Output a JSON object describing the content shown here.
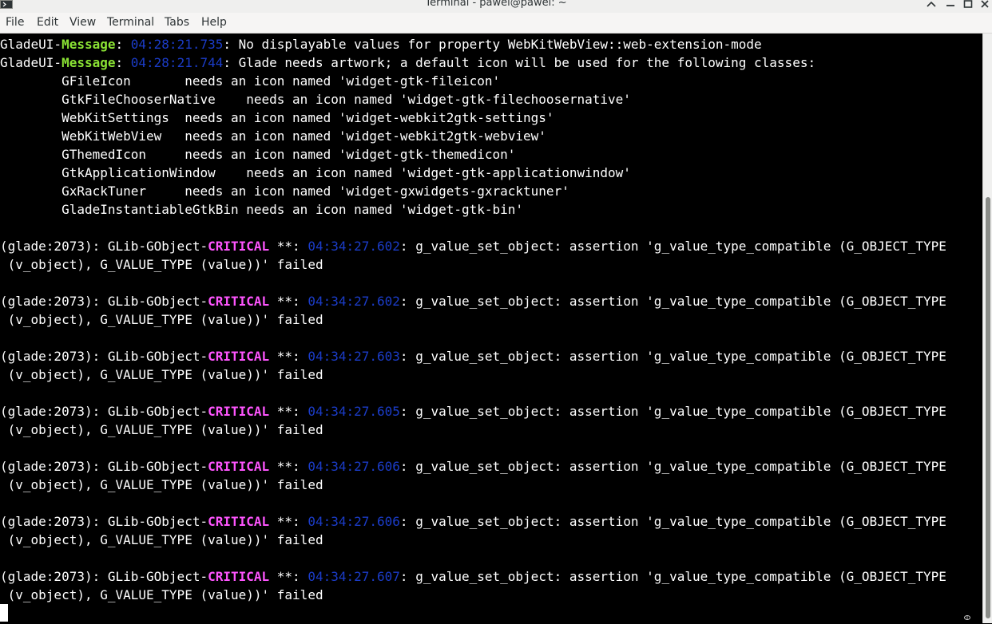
{
  "window": {
    "title": "Terminal - pawel@pawel: ~"
  },
  "menu": [
    "File",
    "Edit",
    "View",
    "Terminal",
    "Tabs",
    "Help"
  ],
  "colors": {
    "background": "#000000",
    "text": "#ffffff",
    "message_accent": "#8ae234",
    "critical_accent": "#ff55ff",
    "timestamp": "#1b3cc8"
  },
  "lines": [
    {
      "segs": [
        {
          "t": "GladeUI-"
        },
        {
          "t": "Message",
          "c": "green"
        },
        {
          "t": ": "
        },
        {
          "t": "04:28:21.735",
          "c": "ts"
        },
        {
          "t": ": No displayable values for property WebKitWebView::web-extension-mode"
        }
      ]
    },
    {
      "segs": [
        {
          "t": "GladeUI-"
        },
        {
          "t": "Message",
          "c": "green"
        },
        {
          "t": ": "
        },
        {
          "t": "04:28:21.744",
          "c": "ts"
        },
        {
          "t": ": Glade needs artwork; a default icon will be used for the following classes:"
        }
      ]
    },
    {
      "segs": [
        {
          "t": "        GFileIcon       needs an icon named 'widget-gtk-fileicon'"
        }
      ]
    },
    {
      "segs": [
        {
          "t": "        GtkFileChooserNative    needs an icon named 'widget-gtk-filechoosernative'"
        }
      ]
    },
    {
      "segs": [
        {
          "t": "        WebKitSettings  needs an icon named 'widget-webkit2gtk-settings'"
        }
      ]
    },
    {
      "segs": [
        {
          "t": "        WebKitWebView   needs an icon named 'widget-webkit2gtk-webview'"
        }
      ]
    },
    {
      "segs": [
        {
          "t": "        GThemedIcon     needs an icon named 'widget-gtk-themedicon'"
        }
      ]
    },
    {
      "segs": [
        {
          "t": "        GtkApplicationWindow    needs an icon named 'widget-gtk-applicationwindow'"
        }
      ]
    },
    {
      "segs": [
        {
          "t": "        GxRackTuner     needs an icon named 'widget-gxwidgets-gxracktuner'"
        }
      ]
    },
    {
      "segs": [
        {
          "t": "        GladeInstantiableGtkBin needs an icon named 'widget-gtk-bin'"
        }
      ]
    },
    {
      "segs": []
    },
    {
      "segs": [
        {
          "t": "(glade:2073): GLib-GObject-"
        },
        {
          "t": "CRITICAL",
          "c": "magenta"
        },
        {
          "t": " **: "
        },
        {
          "t": "04:34:27.602",
          "c": "ts"
        },
        {
          "t": ": g_value_set_object: assertion 'g_value_type_compatible (G_OBJECT_TYPE"
        }
      ]
    },
    {
      "segs": [
        {
          "t": " (v_object), G_VALUE_TYPE (value))' failed"
        }
      ]
    },
    {
      "segs": []
    },
    {
      "segs": [
        {
          "t": "(glade:2073): GLib-GObject-"
        },
        {
          "t": "CRITICAL",
          "c": "magenta"
        },
        {
          "t": " **: "
        },
        {
          "t": "04:34:27.602",
          "c": "ts"
        },
        {
          "t": ": g_value_set_object: assertion 'g_value_type_compatible (G_OBJECT_TYPE"
        }
      ]
    },
    {
      "segs": [
        {
          "t": " (v_object), G_VALUE_TYPE (value))' failed"
        }
      ]
    },
    {
      "segs": []
    },
    {
      "segs": [
        {
          "t": "(glade:2073): GLib-GObject-"
        },
        {
          "t": "CRITICAL",
          "c": "magenta"
        },
        {
          "t": " **: "
        },
        {
          "t": "04:34:27.603",
          "c": "ts"
        },
        {
          "t": ": g_value_set_object: assertion 'g_value_type_compatible (G_OBJECT_TYPE"
        }
      ]
    },
    {
      "segs": [
        {
          "t": " (v_object), G_VALUE_TYPE (value))' failed"
        }
      ]
    },
    {
      "segs": []
    },
    {
      "segs": [
        {
          "t": "(glade:2073): GLib-GObject-"
        },
        {
          "t": "CRITICAL",
          "c": "magenta"
        },
        {
          "t": " **: "
        },
        {
          "t": "04:34:27.605",
          "c": "ts"
        },
        {
          "t": ": g_value_set_object: assertion 'g_value_type_compatible (G_OBJECT_TYPE"
        }
      ]
    },
    {
      "segs": [
        {
          "t": " (v_object), G_VALUE_TYPE (value))' failed"
        }
      ]
    },
    {
      "segs": []
    },
    {
      "segs": [
        {
          "t": "(glade:2073): GLib-GObject-"
        },
        {
          "t": "CRITICAL",
          "c": "magenta"
        },
        {
          "t": " **: "
        },
        {
          "t": "04:34:27.606",
          "c": "ts"
        },
        {
          "t": ": g_value_set_object: assertion 'g_value_type_compatible (G_OBJECT_TYPE"
        }
      ]
    },
    {
      "segs": [
        {
          "t": " (v_object), G_VALUE_TYPE (value))' failed"
        }
      ]
    },
    {
      "segs": []
    },
    {
      "segs": [
        {
          "t": "(glade:2073): GLib-GObject-"
        },
        {
          "t": "CRITICAL",
          "c": "magenta"
        },
        {
          "t": " **: "
        },
        {
          "t": "04:34:27.606",
          "c": "ts"
        },
        {
          "t": ": g_value_set_object: assertion 'g_value_type_compatible (G_OBJECT_TYPE"
        }
      ]
    },
    {
      "segs": [
        {
          "t": " (v_object), G_VALUE_TYPE (value))' failed"
        }
      ]
    },
    {
      "segs": []
    },
    {
      "segs": [
        {
          "t": "(glade:2073): GLib-GObject-"
        },
        {
          "t": "CRITICAL",
          "c": "magenta"
        },
        {
          "t": " **: "
        },
        {
          "t": "04:34:27.607",
          "c": "ts"
        },
        {
          "t": ": g_value_set_object: assertion 'g_value_type_compatible (G_OBJECT_TYPE"
        }
      ]
    },
    {
      "segs": [
        {
          "t": " (v_object), G_VALUE_TYPE (value))' failed"
        }
      ]
    }
  ],
  "icons": {
    "app": "terminal-icon",
    "minimize": "minimize-icon",
    "maximize": "maximize-icon",
    "close": "close-icon"
  }
}
